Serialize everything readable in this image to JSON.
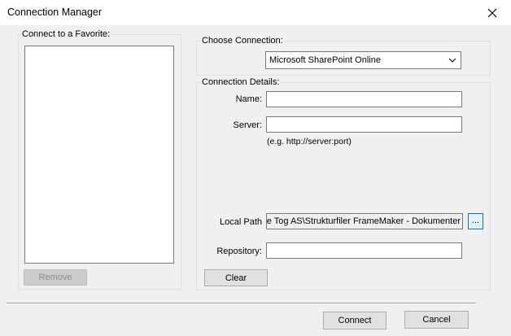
{
  "window": {
    "title": "Connection Manager",
    "close_icon": "close-icon"
  },
  "favorites": {
    "group_label": "Connect to a Favorite:",
    "items": [],
    "remove_label": "Remove"
  },
  "choose_connection": {
    "group_label": "Choose Connection:",
    "selected": "Microsoft SharePoint Online",
    "dropdown_icon": "chevron-down-icon"
  },
  "details": {
    "group_label": "Connection Details:",
    "name_label": "Name:",
    "name_value": "",
    "server_label": "Server:",
    "server_value": "",
    "server_hint": "(e.g. http://server:port)",
    "local_path_label": "Local Path",
    "local_path_value": "ke Tog AS\\Strukturfiler FrameMaker - Dokumenter",
    "browse_label": "...",
    "repository_label": "Repository:",
    "repository_value": "",
    "clear_label": "Clear"
  },
  "footer": {
    "connect_label": "Connect",
    "cancel_label": "Cancel"
  },
  "colors": {
    "dialog_bg": "#f0f0f0",
    "focus_accent": "#0078d7",
    "disabled_text": "#8d8d8d"
  }
}
